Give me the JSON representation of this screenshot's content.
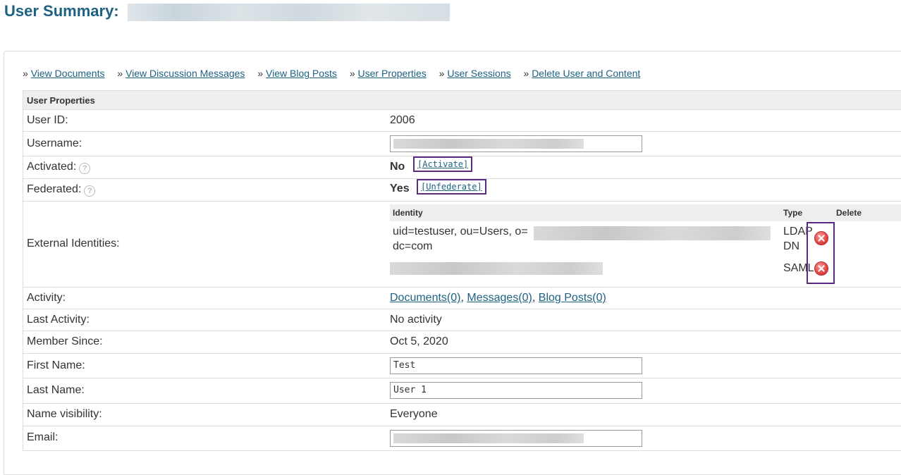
{
  "header": {
    "title": "User Summary:"
  },
  "actions": [
    {
      "prefix": "»",
      "label": "View Documents"
    },
    {
      "prefix": "»",
      "label": "View Discussion Messages"
    },
    {
      "prefix": "»",
      "label": "View Blog Posts"
    },
    {
      "prefix": "»",
      "label": "User Properties"
    },
    {
      "prefix": "»",
      "label": "User Sessions"
    },
    {
      "prefix": "»",
      "label": "Delete User and Content"
    }
  ],
  "props": {
    "section_title": "User Properties",
    "user_id": {
      "label": "User ID:",
      "value": "2006"
    },
    "username": {
      "label": "Username:"
    },
    "activated": {
      "label": "Activated:",
      "value": "No",
      "action": "[Activate]"
    },
    "federated": {
      "label": "Federated:",
      "value": "Yes",
      "action": "[Unfederate]"
    },
    "external": {
      "label": "External Identities:",
      "headers": {
        "identity": "Identity",
        "type": "Type",
        "delete": "Delete"
      },
      "rows": [
        {
          "identity_line1": "uid=testuser, ou=Users, o=",
          "identity_line2": "dc=com",
          "type_line1": "LDAP",
          "type_line2": "DN"
        },
        {
          "type_line1": "SAML"
        }
      ]
    },
    "activity": {
      "label": "Activity:",
      "documents": "Documents(0)",
      "messages": "Messages(0)",
      "blog_posts": "Blog Posts(0)",
      "sep": ","
    },
    "last_activity": {
      "label": "Last Activity:",
      "value": "No activity"
    },
    "member_since": {
      "label": "Member Since:",
      "value": "Oct 5, 2020"
    },
    "first_name": {
      "label": "First Name:",
      "value": "Test"
    },
    "last_name": {
      "label": "Last Name:",
      "value": "User 1"
    },
    "name_visibility": {
      "label": "Name visibility:",
      "value": "Everyone"
    },
    "email": {
      "label": "Email:"
    }
  },
  "colors": {
    "title": "#1d6282",
    "link": "#1d6282",
    "no": "#cc0000",
    "highlight_border": "#5b2b82"
  },
  "icons": {
    "help": "question-circle-icon",
    "delete": "delete-x-circle-icon"
  }
}
